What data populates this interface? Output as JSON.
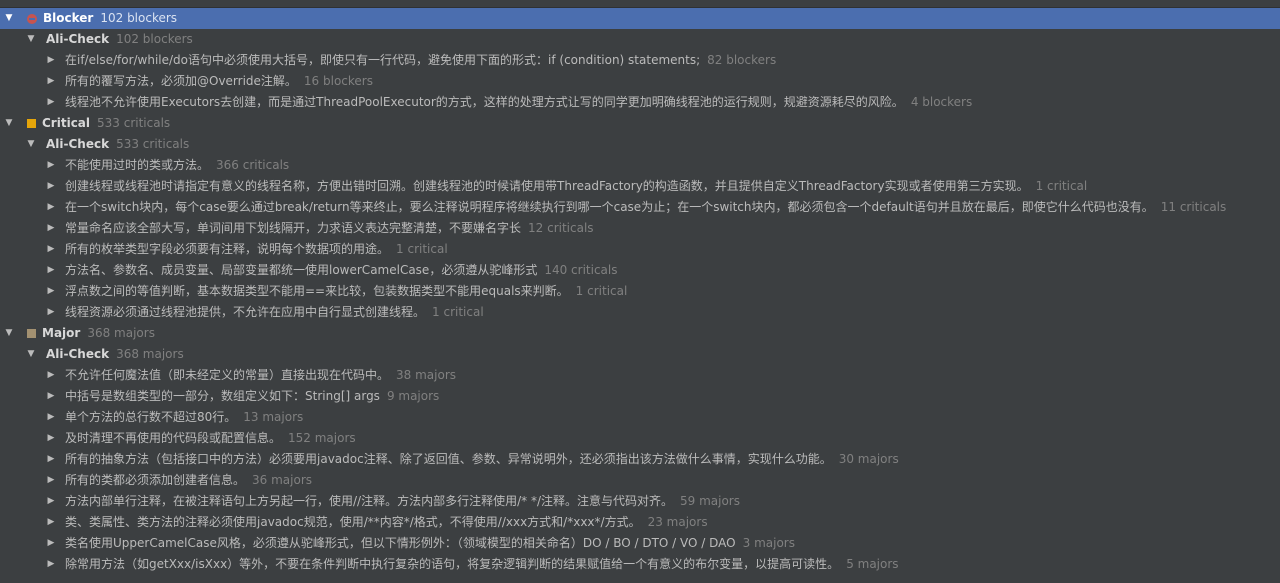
{
  "groups": [
    {
      "severity": "Blocker",
      "severity_count": "102 blockers",
      "icon": "blocker-icon",
      "selected": true,
      "category": "Ali-Check",
      "category_count": "102 blockers",
      "rules": [
        {
          "text": "在if/else/for/while/do语句中必须使用大括号，即使只有一行代码，避免使用下面的形式：if (condition) statements;",
          "count": "82 blockers"
        },
        {
          "text": "所有的覆写方法，必须加@Override注解。",
          "count": "16 blockers"
        },
        {
          "text": "线程池不允许使用Executors去创建，而是通过ThreadPoolExecutor的方式，这样的处理方式让写的同学更加明确线程池的运行规则，规避资源耗尽的风险。",
          "count": "4 blockers"
        }
      ]
    },
    {
      "severity": "Critical",
      "severity_count": "533 criticals",
      "icon": "critical-icon",
      "selected": false,
      "category": "Ali-Check",
      "category_count": "533 criticals",
      "rules": [
        {
          "text": "不能使用过时的类或方法。",
          "count": "366 criticals"
        },
        {
          "text": "创建线程或线程池时请指定有意义的线程名称，方便出错时回溯。创建线程池的时候请使用带ThreadFactory的构造函数，并且提供自定义ThreadFactory实现或者使用第三方实现。",
          "count": "1 critical"
        },
        {
          "text": "在一个switch块内，每个case要么通过break/return等来终止，要么注释说明程序将继续执行到哪一个case为止；在一个switch块内，都必须包含一个default语句并且放在最后，即使它什么代码也没有。",
          "count": "11 criticals"
        },
        {
          "text": "常量命名应该全部大写，单词间用下划线隔开，力求语义表达完整清楚，不要嫌名字长",
          "count": "12 criticals"
        },
        {
          "text": "所有的枚举类型字段必须要有注释，说明每个数据项的用途。",
          "count": "1 critical"
        },
        {
          "text": "方法名、参数名、成员变量、局部变量都统一使用lowerCamelCase，必须遵从驼峰形式",
          "count": "140 criticals"
        },
        {
          "text": "浮点数之间的等值判断，基本数据类型不能用==来比较，包装数据类型不能用equals来判断。",
          "count": "1 critical"
        },
        {
          "text": "线程资源必须通过线程池提供，不允许在应用中自行显式创建线程。",
          "count": "1 critical"
        }
      ]
    },
    {
      "severity": "Major",
      "severity_count": "368 majors",
      "icon": "major-icon",
      "selected": false,
      "category": "Ali-Check",
      "category_count": "368 majors",
      "rules": [
        {
          "text": "不允许任何魔法值（即未经定义的常量）直接出现在代码中。",
          "count": "38 majors"
        },
        {
          "text": "中括号是数组类型的一部分，数组定义如下：String[] args",
          "count": "9 majors"
        },
        {
          "text": "单个方法的总行数不超过80行。",
          "count": "13 majors"
        },
        {
          "text": "及时清理不再使用的代码段或配置信息。",
          "count": "152 majors"
        },
        {
          "text": "所有的抽象方法（包括接口中的方法）必须要用javadoc注释、除了返回值、参数、异常说明外，还必须指出该方法做什么事情，实现什么功能。",
          "count": "30 majors"
        },
        {
          "text": "所有的类都必须添加创建者信息。",
          "count": "36 majors"
        },
        {
          "text": "方法内部单行注释，在被注释语句上方另起一行，使用//注释。方法内部多行注释使用/* */注释。注意与代码对齐。",
          "count": "59 majors"
        },
        {
          "text": "类、类属性、类方法的注释必须使用javadoc规范，使用/**内容*/格式，不得使用//xxx方式和/*xxx*/方式。",
          "count": "23 majors"
        },
        {
          "text": "类名使用UpperCamelCase风格，必须遵从驼峰形式，但以下情形例外：（领域模型的相关命名）DO / BO / DTO / VO / DAO",
          "count": "3 majors"
        },
        {
          "text": "除常用方法（如getXxx/isXxx）等外，不要在条件判断中执行复杂的语句，将复杂逻辑判断的结果赋值给一个有意义的布尔变量，以提高可读性。",
          "count": "5 majors"
        }
      ]
    }
  ],
  "icons": {
    "expanded": "chevron-down-icon",
    "collapsed": "chevron-right-icon"
  }
}
